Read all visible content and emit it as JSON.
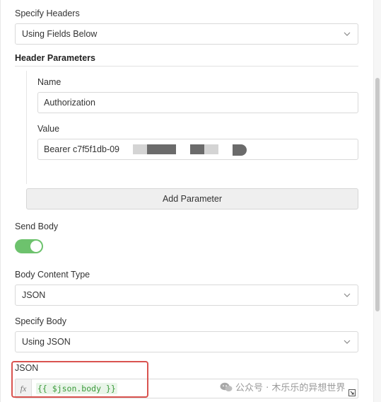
{
  "specify_headers": {
    "label": "Specify Headers",
    "value": "Using Fields Below"
  },
  "header_parameters": {
    "title": "Header Parameters",
    "name_label": "Name",
    "name_value": "Authorization",
    "value_label": "Value",
    "value_value": "Bearer c7f5f1db-09",
    "add_button": "Add Parameter"
  },
  "send_body": {
    "label": "Send Body",
    "enabled": true
  },
  "body_content_type": {
    "label": "Body Content Type",
    "value": "JSON"
  },
  "specify_body": {
    "label": "Specify Body",
    "value": "Using JSON"
  },
  "json_field": {
    "label": "JSON",
    "fx": "fx",
    "expression": "{{ $json.body }}"
  },
  "watermark": {
    "text": "公众号 · 木乐乐的异想世界"
  },
  "colors": {
    "toggle_on": "#6dc26d",
    "highlight": "#d9534f",
    "expression": "#3a9a3a"
  }
}
